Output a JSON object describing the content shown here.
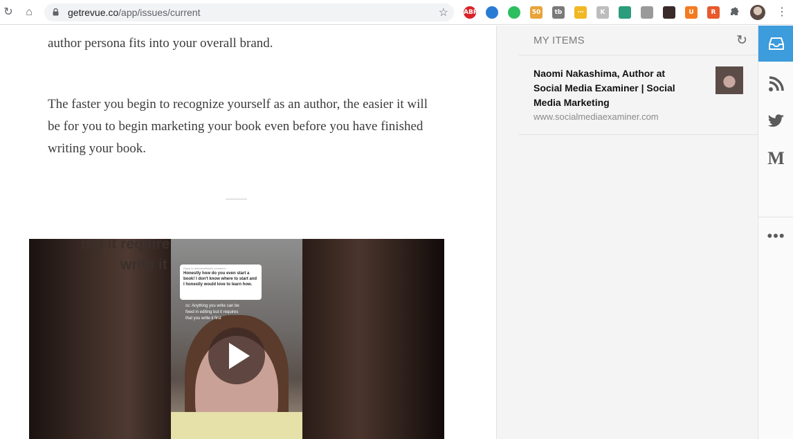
{
  "browser": {
    "url_host": "getrevue.co",
    "url_path": "/app/issues/current",
    "extensions": [
      {
        "name": "adblock-icon",
        "label": "ABP",
        "color": "#d8222a"
      },
      {
        "name": "sailfish-icon",
        "label": "",
        "color": "#2a7bd4"
      },
      {
        "name": "evernote-icon",
        "label": "",
        "color": "#2dbe60"
      },
      {
        "name": "so-icon",
        "label": "50",
        "color": "#e8a33a"
      },
      {
        "name": "tb-icon",
        "label": "tb",
        "color": "#7a7a7a"
      },
      {
        "name": "sticky-icon",
        "label": "⋯",
        "color": "#f2b824"
      },
      {
        "name": "k-icon",
        "label": "K",
        "color": "#bdbdbd"
      },
      {
        "name": "feedly-icon",
        "label": "",
        "color": "#2b9c7c"
      },
      {
        "name": "camera-icon",
        "label": "",
        "color": "#9a9a9a"
      },
      {
        "name": "readwise-icon",
        "label": "",
        "color": "#3a2a2a"
      },
      {
        "name": "u-icon",
        "label": "U",
        "color": "#f47a20"
      },
      {
        "name": "r-icon",
        "label": "R",
        "color": "#e85a2c"
      }
    ]
  },
  "article": {
    "p1": "author persona fits into your overall brand.",
    "p2": "The faster you begin to recognize yourself as an author, the easier it will be for you to begin marketing your book even before you have finished writing your book.",
    "video": {
      "ghost_text_1": "but it require",
      "ghost_text_2": "write it",
      "reply_head": "Reply to authorsofficial's comment",
      "reply_body": "Honestly how do you even start a book! I don't know where to start and I honestly would love to learn how.",
      "overlay_text": "cc: Anything you write can be fixed in editing but it requires that you write it first"
    }
  },
  "panel": {
    "title": "MY ITEMS",
    "items": [
      {
        "title": "Naomi Nakashima, Author at Social Media Examiner | Social Media Marketing",
        "source": "www.socialmediaexaminer.com"
      }
    ]
  },
  "rail": {
    "buttons": [
      "inbox-icon",
      "rss-icon",
      "twitter-icon",
      "medium-icon",
      "more-icon"
    ]
  }
}
